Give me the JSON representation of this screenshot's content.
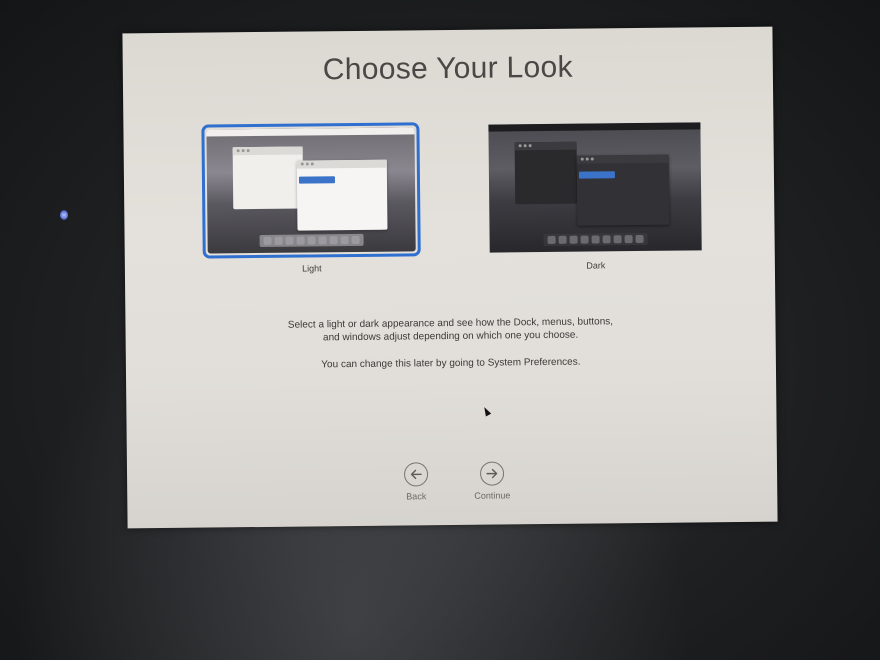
{
  "title": "Choose Your Look",
  "options": [
    {
      "label": "Light",
      "selected": true
    },
    {
      "label": "Dark",
      "selected": false
    }
  ],
  "description": {
    "line1": "Select a light or dark appearance and see how the Dock, menus, buttons,",
    "line2": "and windows adjust depending on which one you choose.",
    "note": "You can change this later by going to System Preferences."
  },
  "navigation": {
    "back_label": "Back",
    "back_icon": "arrow-left-icon",
    "continue_label": "Continue",
    "continue_icon": "arrow-right-icon"
  },
  "colors": {
    "selection_accent": "#2f6fcf"
  }
}
